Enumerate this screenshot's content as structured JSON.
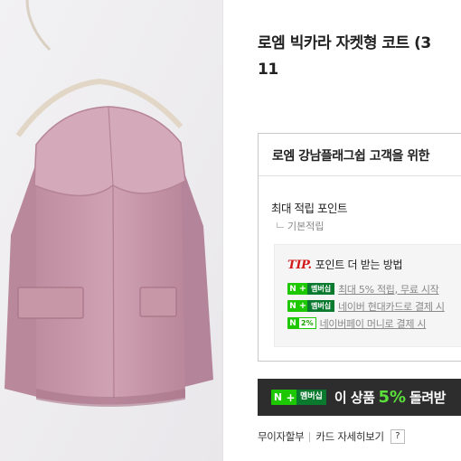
{
  "product": {
    "title_line1": "로엠 빅카라 자켓형 코트 (3",
    "title_line2": "11",
    "image_subject": "pink-wool-jacket-on-hanger"
  },
  "benefits": {
    "header": "로엠 강남플래그쉽 고객을 위한",
    "max_points_label": "최대 적립 포인트",
    "basic_points_label": "기본적립",
    "tip": {
      "mark": "TIP.",
      "title": "포인트 더 받는 방법",
      "items": [
        {
          "badge": "멤버십",
          "text": "최대 5% 적립, 무료 시작"
        },
        {
          "badge": "멤버십",
          "text": "네이버 현대카드로 결제 시"
        },
        {
          "badge": "2%",
          "text": "네이버페이 머니로 결제 시"
        }
      ]
    }
  },
  "promo": {
    "badge_label": "멤버십",
    "text_before": "이 상품",
    "percent": "5%",
    "text_after": "돌려받"
  },
  "installment": {
    "label": "무이자할부",
    "details_link": "카드 자세히보기",
    "help": "?"
  },
  "colors": {
    "naver_green": "#1ec800",
    "promo_background": "#2d2d2d",
    "tip_accent": "#d11a1a",
    "jacket_pink": "#c89aab"
  }
}
